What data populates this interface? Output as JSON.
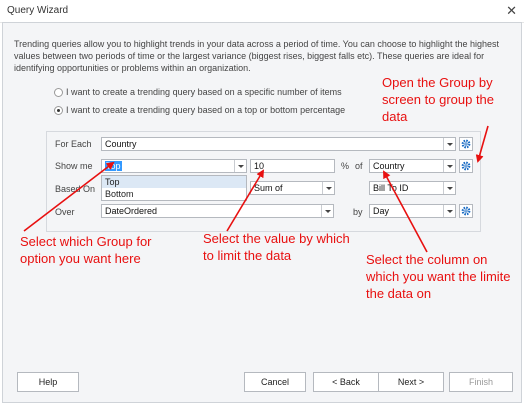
{
  "window": {
    "title": "Query Wizard",
    "close_glyph": "✕"
  },
  "description": "Trending queries allow you to highlight trends in your data across a period of time. You can choose to highlight the highest values between two periods of time or the largest variance (biggest rises, biggest falls etc). These queries are ideal for identifying opportunities or problems within an organization.",
  "options": {
    "specific_number": {
      "label": "I want to create a trending query based on a specific number of items",
      "checked": false
    },
    "percentage": {
      "label": "I want to create a trending query based on a top or bottom percentage",
      "checked": true
    }
  },
  "form": {
    "for_each": {
      "label": "For Each",
      "value": "Country"
    },
    "show_me": {
      "label": "Show me",
      "value": "Top",
      "options": [
        "Top",
        "Bottom"
      ],
      "amount": "10",
      "percent_label": "%",
      "of_label": "of",
      "of_value": "Country"
    },
    "based_on": {
      "label": "Based On",
      "aggregate": "Sum of",
      "column": "Bill To ID"
    },
    "over": {
      "label": "Over",
      "value": "DateOrdered",
      "by_label": "by",
      "by_value": "Day"
    }
  },
  "annotations": {
    "group_by": "Open the Group by screen to group the data",
    "select_group": "Select which Group for option you want here",
    "select_value": "Select the value by which to limit the data",
    "select_column": "Select the column on which you want the limite the data on",
    "color": "#e81010"
  },
  "buttons": {
    "help": "Help",
    "cancel": "Cancel",
    "back": "< Back",
    "next": "Next >",
    "finish": "Finish"
  },
  "icons": {
    "settings": "gear-icon",
    "dropdown": "chevron-down-icon"
  },
  "colors": {
    "accent": "#1f6fc5",
    "selection": "#3399ff",
    "annotation": "#e81010"
  }
}
